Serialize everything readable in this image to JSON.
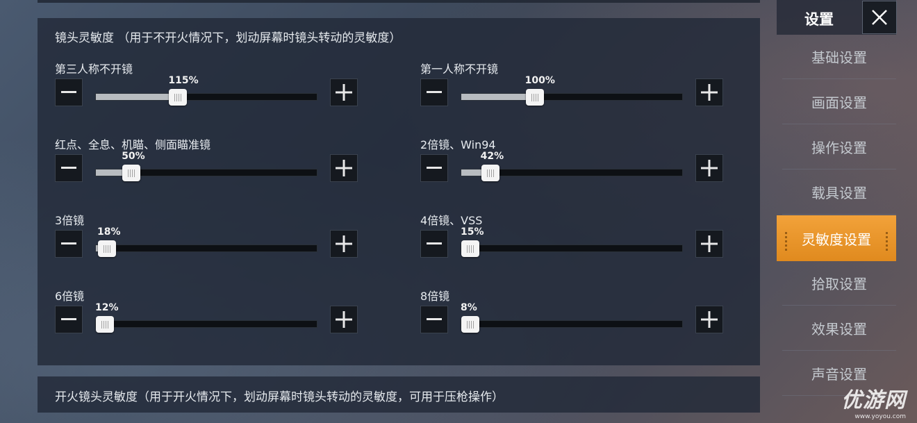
{
  "sensitivity_panel": {
    "title": "镜头灵敏度  （用于不开火情况下，划动屏幕时镜头转动的灵敏度）",
    "sliders": [
      {
        "label": "第三人称不开镜",
        "percent_text": "115%",
        "fill": 0.37
      },
      {
        "label": "第一人称不开镜",
        "percent_text": "100%",
        "fill": 0.33
      },
      {
        "label": "红点、全息、机瞄、侧面瞄准镜",
        "percent_text": "50%",
        "fill": 0.16
      },
      {
        "label": "2倍镜、Win94",
        "percent_text": "42%",
        "fill": 0.13
      },
      {
        "label": "3倍镜",
        "percent_text": "18%",
        "fill": 0.05
      },
      {
        "label": "4倍镜、VSS",
        "percent_text": "15%",
        "fill": 0.04
      },
      {
        "label": "6倍镜",
        "percent_text": "12%",
        "fill": 0.03
      },
      {
        "label": "8倍镜",
        "percent_text": "8%",
        "fill": 0.02
      }
    ]
  },
  "fire_panel": {
    "title": "开火镜头灵敏度（用于开火情况下，划动屏幕时镜头转动的灵敏度，可用于压枪操作）"
  },
  "sidebar": {
    "title": "设置",
    "items": [
      {
        "label": "基础设置",
        "active": false
      },
      {
        "label": "画面设置",
        "active": false
      },
      {
        "label": "操作设置",
        "active": false
      },
      {
        "label": "载具设置",
        "active": false
      },
      {
        "label": "灵敏度设置",
        "active": true
      },
      {
        "label": "拾取设置",
        "active": false
      },
      {
        "label": "效果设置",
        "active": false
      },
      {
        "label": "声音设置",
        "active": false
      }
    ]
  },
  "watermark": {
    "logo": "优游网",
    "url": "www.yoyou.com"
  },
  "colors": {
    "accent": "#f2a23a",
    "panel": "#222a38",
    "track": "#0d1014",
    "knob": "#f4f4f4"
  }
}
